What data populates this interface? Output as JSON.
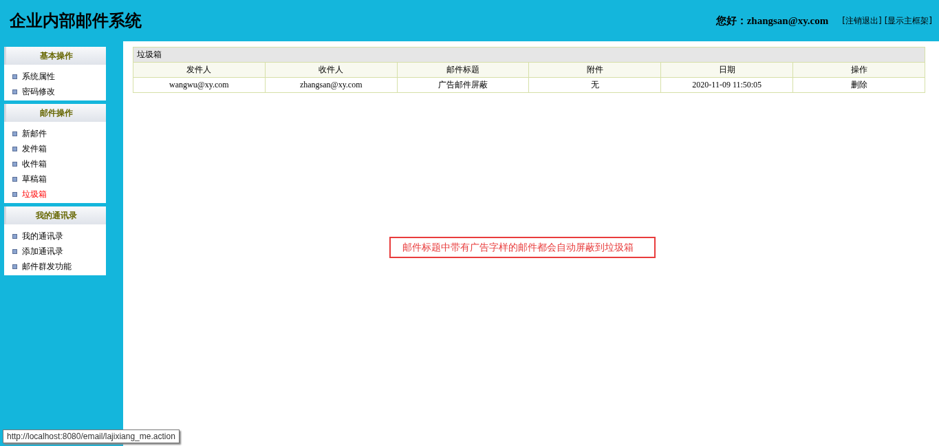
{
  "header": {
    "title": "企业内部邮件系统",
    "greeting": "您好：zhangsan@xy.com",
    "links": [
      "[注销退出]",
      "[显示主框架]"
    ]
  },
  "sidebar": {
    "sections": [
      {
        "title": "基本操作",
        "items": [
          {
            "label": "系统属性",
            "selected": false
          },
          {
            "label": "密码修改",
            "selected": false
          }
        ]
      },
      {
        "title": "邮件操作",
        "items": [
          {
            "label": "新邮件",
            "selected": false
          },
          {
            "label": "发件箱",
            "selected": false
          },
          {
            "label": "收件箱",
            "selected": false
          },
          {
            "label": "草稿箱",
            "selected": false
          },
          {
            "label": "垃圾箱",
            "selected": true
          }
        ]
      },
      {
        "title": "我的通讯录",
        "items": [
          {
            "label": "我的通讯录",
            "selected": false
          },
          {
            "label": "添加通讯录",
            "selected": false
          },
          {
            "label": "邮件群发功能",
            "selected": false
          }
        ]
      }
    ]
  },
  "table": {
    "caption": "垃圾箱",
    "columns": [
      "发件人",
      "收件人",
      "邮件标题",
      "附件",
      "日期",
      "操作"
    ],
    "rows": [
      {
        "cells": [
          "wangwu@xy.com",
          "zhangsan@xy.com",
          "广告邮件屏蔽",
          "无",
          "2020-11-09 11:50:05",
          "删除"
        ]
      }
    ]
  },
  "notice": "邮件标题中带有广告字样的邮件都会自动屏蔽到垃圾箱",
  "status_bar": "http://localhost:8080/email/lajixiang_me.action"
}
